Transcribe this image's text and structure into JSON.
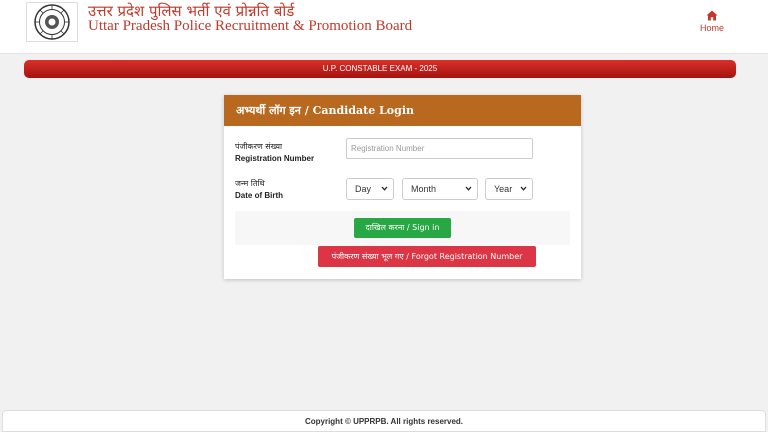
{
  "header": {
    "title_hindi": "उत्तर प्रदेश पुलिस भर्ती एवं प्रोन्नति बोर्ड",
    "title_english": "Uttar Pradesh Police Recruitment & Promotion Board",
    "logo_icon": "up-police-emblem-icon",
    "home_label": "Home",
    "home_icon": "home-icon"
  },
  "exam_banner": "U.P. CONSTABLE EXAM - 2025",
  "login": {
    "title": "अभ्यर्थी लॉग इन / Candidate Login",
    "registration_label_hindi": "पंजीकरण संख्या",
    "registration_label_english": "Registration Number",
    "registration_placeholder": "Registration Number",
    "registration_value": "",
    "dob_label_hindi": "जन्म तिथि",
    "dob_label_english": "Date of Birth",
    "day_selected": "Day",
    "month_selected": "Month",
    "year_selected": "Year",
    "signin_label": "दाखिल करना / Sign in",
    "forgot_label": "पंजीकरण संख्या भूल गए / Forgot Registration Number"
  },
  "footer": {
    "copyright": "Copyright © UPPRPB. All rights reserved."
  },
  "colors": {
    "brand_red": "#c0392b",
    "card_header": "#b8691f",
    "signin_green": "#28a745",
    "forgot_red": "#dc3545"
  }
}
